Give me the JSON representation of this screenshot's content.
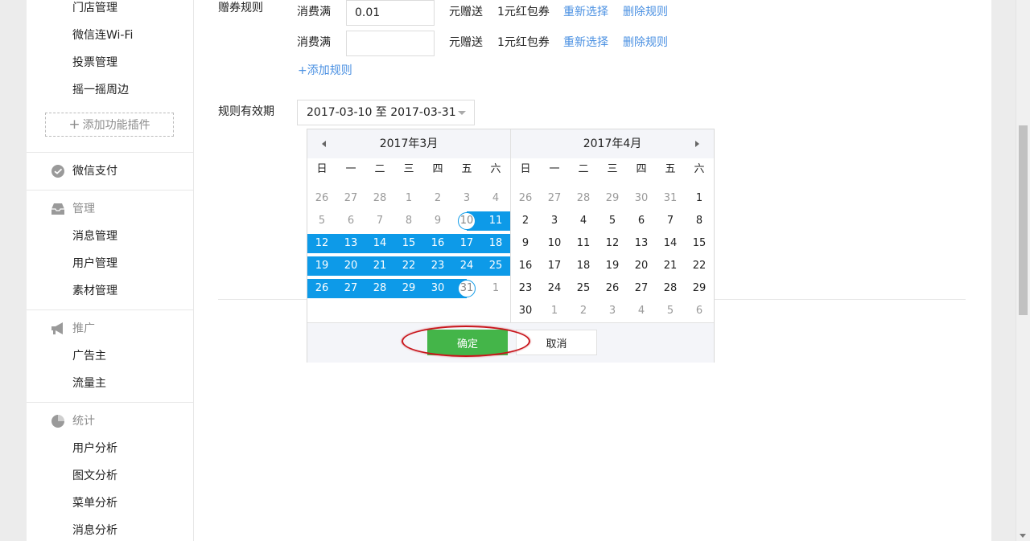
{
  "sidebar": {
    "top_items": [
      "门店管理",
      "微信连Wi-Fi",
      "投票管理",
      "摇一摇周边"
    ],
    "add_plugin": "添加功能插件",
    "wechat_pay": "微信支付",
    "manage": {
      "title": "管理",
      "items": [
        "消息管理",
        "用户管理",
        "素材管理"
      ]
    },
    "promote": {
      "title": "推广",
      "items": [
        "广告主",
        "流量主"
      ]
    },
    "stats": {
      "title": "统计",
      "items": [
        "用户分析",
        "图文分析",
        "菜单分析",
        "消息分析"
      ]
    }
  },
  "form": {
    "coupon_rule_label": "赠券规则",
    "rules": [
      {
        "prefix": "消费满",
        "value": "0.01",
        "suffix": "元赠送",
        "coupon": "1元红包券",
        "reselect": "重新选择",
        "delete": "删除规则"
      },
      {
        "prefix": "消费满",
        "value": "",
        "suffix": "元赠送",
        "coupon": "1元红包券",
        "reselect": "重新选择",
        "delete": "删除规则"
      }
    ],
    "add_rule": "+添加规则",
    "validity_label": "规则有效期",
    "date_range": "2017-03-10 至 2017-03-31"
  },
  "calendar": {
    "weekdays": [
      "日",
      "一",
      "二",
      "三",
      "四",
      "五",
      "六"
    ],
    "left": {
      "title": "2017年3月",
      "days": [
        [
          26,
          "other"
        ],
        [
          27,
          "other"
        ],
        [
          28,
          "other"
        ],
        [
          1,
          "other"
        ],
        [
          2,
          "other"
        ],
        [
          3,
          "other"
        ],
        [
          4,
          "other"
        ],
        [
          5,
          "other"
        ],
        [
          6,
          "other"
        ],
        [
          7,
          "other"
        ],
        [
          8,
          "other"
        ],
        [
          9,
          "other"
        ],
        [
          10,
          "start"
        ],
        [
          11,
          "range"
        ],
        [
          12,
          "range"
        ],
        [
          13,
          "range"
        ],
        [
          14,
          "range"
        ],
        [
          15,
          "range"
        ],
        [
          16,
          "range"
        ],
        [
          17,
          "range"
        ],
        [
          18,
          "range"
        ],
        [
          19,
          "range"
        ],
        [
          20,
          "range"
        ],
        [
          21,
          "range"
        ],
        [
          22,
          "range"
        ],
        [
          23,
          "range"
        ],
        [
          24,
          "range"
        ],
        [
          25,
          "range"
        ],
        [
          26,
          "range"
        ],
        [
          27,
          "range"
        ],
        [
          28,
          "range"
        ],
        [
          29,
          "range"
        ],
        [
          30,
          "range"
        ],
        [
          31,
          "end"
        ],
        [
          1,
          "other"
        ]
      ]
    },
    "right": {
      "title": "2017年4月",
      "days": [
        [
          26,
          "other"
        ],
        [
          27,
          "other"
        ],
        [
          28,
          "other"
        ],
        [
          29,
          "other"
        ],
        [
          30,
          "other"
        ],
        [
          31,
          "other"
        ],
        [
          1,
          "cur"
        ],
        [
          2,
          "cur"
        ],
        [
          3,
          "cur"
        ],
        [
          4,
          "cur"
        ],
        [
          5,
          "cur"
        ],
        [
          6,
          "cur"
        ],
        [
          7,
          "cur"
        ],
        [
          8,
          "cur"
        ],
        [
          9,
          "cur"
        ],
        [
          10,
          "cur"
        ],
        [
          11,
          "cur"
        ],
        [
          12,
          "cur"
        ],
        [
          13,
          "cur"
        ],
        [
          14,
          "cur"
        ],
        [
          15,
          "cur"
        ],
        [
          16,
          "cur"
        ],
        [
          17,
          "cur"
        ],
        [
          18,
          "cur"
        ],
        [
          19,
          "cur"
        ],
        [
          20,
          "cur"
        ],
        [
          21,
          "cur"
        ],
        [
          22,
          "cur"
        ],
        [
          23,
          "cur"
        ],
        [
          24,
          "cur"
        ],
        [
          25,
          "cur"
        ],
        [
          26,
          "cur"
        ],
        [
          27,
          "cur"
        ],
        [
          28,
          "cur"
        ],
        [
          29,
          "cur"
        ],
        [
          30,
          "cur"
        ],
        [
          1,
          "other"
        ],
        [
          2,
          "other"
        ],
        [
          3,
          "other"
        ],
        [
          4,
          "other"
        ],
        [
          5,
          "other"
        ],
        [
          6,
          "other"
        ]
      ]
    },
    "ok": "确定",
    "cancel": "取消"
  },
  "colors": {
    "accent": "#44b549",
    "range": "#0d9ae8",
    "link": "#4a90e2",
    "highlight": "#c8151b"
  }
}
